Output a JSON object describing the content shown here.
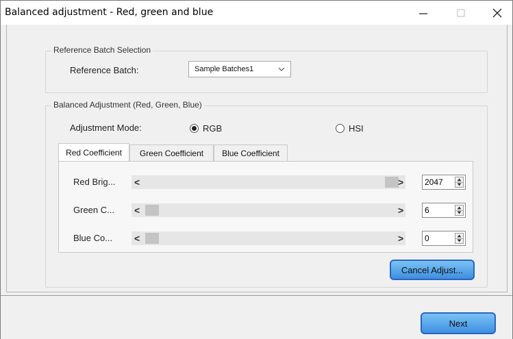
{
  "window": {
    "title": "Balanced adjustment - Red, green and blue"
  },
  "reference_group": {
    "legend": "Reference Batch Selection",
    "label": "Reference Batch:",
    "combo_value": "Sample Batches1"
  },
  "balance_group": {
    "legend": "Balanced Adjustment (Red, Green, Blue)",
    "mode_label": "Adjustment Mode:",
    "mode_options": [
      {
        "label": "RGB",
        "selected": true
      },
      {
        "label": "HSI",
        "selected": false
      }
    ],
    "tabs": [
      {
        "label": "Red Coefficient",
        "active": true
      },
      {
        "label": "Green Coefficient",
        "active": false
      },
      {
        "label": "Blue Coefficient",
        "active": false
      }
    ],
    "rows": [
      {
        "label": "Red Brig...",
        "value": "2047",
        "position": 1.0
      },
      {
        "label": "Green C...",
        "value": "6",
        "position": 0.0
      },
      {
        "label": "Blue Co...",
        "value": "0",
        "position": 0.0
      }
    ],
    "cancel_label": "Cancel Adjust..."
  },
  "footer": {
    "next_label": "Next"
  },
  "colors": {
    "button_fill": "#5aa8ec",
    "button_border": "#2a64c2",
    "window_bg": "#f0f0f0"
  }
}
